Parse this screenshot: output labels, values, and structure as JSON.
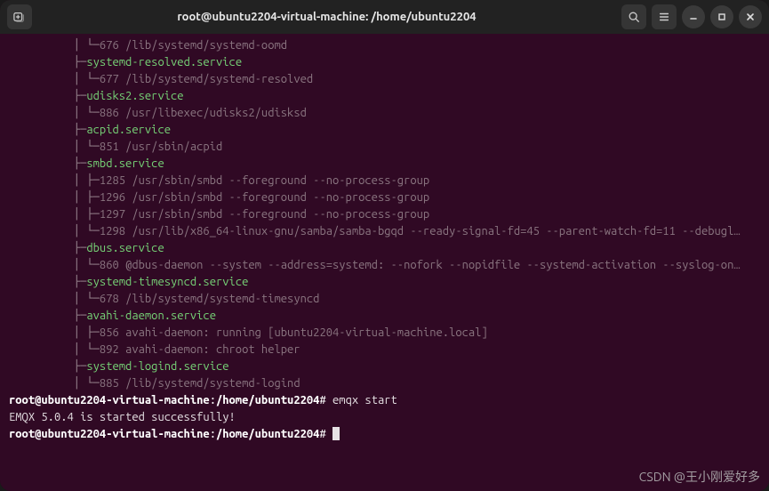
{
  "title": "root@ubuntu2204-virtual-machine: /home/ubuntu2204",
  "tree": [
    {
      "indent": 4,
      "corner": true,
      "pid": "676",
      "text": "/lib/systemd/systemd-oomd",
      "style": "dim"
    },
    {
      "indent": 3,
      "branch": true,
      "text": "systemd-resolved.service",
      "style": "svc"
    },
    {
      "indent": 4,
      "corner": true,
      "pid": "677",
      "text": "/lib/systemd/systemd-resolved",
      "style": "dim"
    },
    {
      "indent": 3,
      "branch": true,
      "text": "udisks2.service",
      "style": "svc"
    },
    {
      "indent": 4,
      "corner": true,
      "pid": "886",
      "text": "/usr/libexec/udisks2/udisksd",
      "style": "dim"
    },
    {
      "indent": 3,
      "branch": true,
      "text": "acpid.service",
      "style": "svc"
    },
    {
      "indent": 4,
      "corner": true,
      "pid": "851",
      "text": "/usr/sbin/acpid",
      "style": "dim"
    },
    {
      "indent": 3,
      "branch": true,
      "text": "smbd.service",
      "style": "svc"
    },
    {
      "indent": 4,
      "branch": true,
      "pid": "1285",
      "text": "/usr/sbin/smbd --foreground --no-process-group",
      "style": "dim"
    },
    {
      "indent": 4,
      "branch": true,
      "pid": "1296",
      "text": "/usr/sbin/smbd --foreground --no-process-group",
      "style": "dim"
    },
    {
      "indent": 4,
      "branch": true,
      "pid": "1297",
      "text": "/usr/sbin/smbd --foreground --no-process-group",
      "style": "dim"
    },
    {
      "indent": 4,
      "corner": true,
      "pid": "1298",
      "text": "/usr/lib/x86_64-linux-gnu/samba/samba-bgqd --ready-signal-fd=45 --parent-watch-fd=11 --debugl…",
      "style": "dim"
    },
    {
      "indent": 3,
      "branch": true,
      "text": "dbus.service",
      "style": "svc"
    },
    {
      "indent": 4,
      "corner": true,
      "pid": "860",
      "text": "@dbus-daemon --system --address=systemd: --nofork --nopidfile --systemd-activation --syslog-on…",
      "style": "dim"
    },
    {
      "indent": 3,
      "branch": true,
      "text": "systemd-timesyncd.service",
      "style": "svc"
    },
    {
      "indent": 4,
      "corner": true,
      "pid": "678",
      "text": "/lib/systemd/systemd-timesyncd",
      "style": "dim"
    },
    {
      "indent": 3,
      "branch": true,
      "text": "avahi-daemon.service",
      "style": "svc"
    },
    {
      "indent": 4,
      "branch": true,
      "pid": "856",
      "text": "avahi-daemon: running [ubuntu2204-virtual-machine.local]",
      "style": "dim"
    },
    {
      "indent": 4,
      "corner": true,
      "pid": "892",
      "text": "avahi-daemon: chroot helper",
      "style": "dim"
    },
    {
      "indent": 3,
      "branch": true,
      "text": "systemd-logind.service",
      "style": "svc"
    },
    {
      "indent": 4,
      "corner": true,
      "pid": "885",
      "text": "/lib/systemd/systemd-logind",
      "style": "dim"
    }
  ],
  "prompt": {
    "user_host": "root@ubuntu2204-virtual-machine",
    "path": "/home/ubuntu2204",
    "sep": ":",
    "sym": "#"
  },
  "command1": "emqx start",
  "message": "EMQX 5.0.4 is started successfully!",
  "watermark": "CSDN @王小刚爱好多"
}
